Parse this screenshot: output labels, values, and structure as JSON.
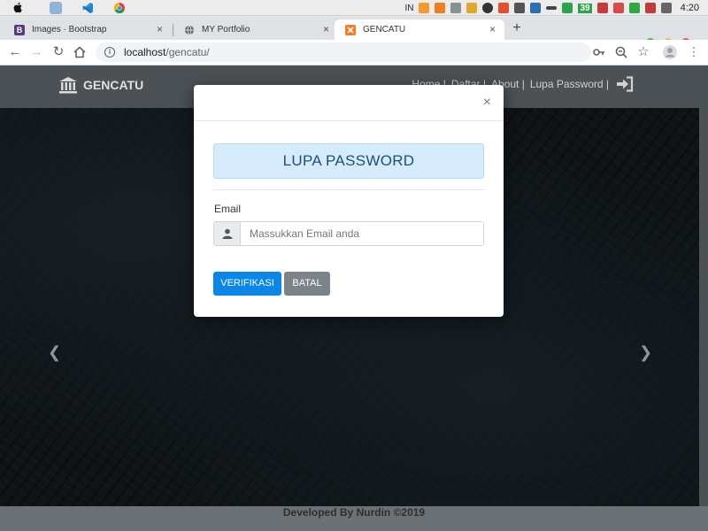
{
  "menubar": {
    "input_source": "IN",
    "badge_count": "39",
    "clock": "4:20"
  },
  "browser": {
    "tabs": [
      {
        "label": "Images · Bootstrap",
        "favicon": "B",
        "favicon_color": "#563d7c",
        "active": false
      },
      {
        "label": "MY Portfolio",
        "favicon": "globe",
        "active": false
      },
      {
        "label": "GENCATU",
        "favicon": "xampp",
        "favicon_color": "#fb7a24",
        "active": true
      }
    ],
    "new_tab": "+",
    "address": {
      "host": "localhost",
      "path": "/gencatu/"
    }
  },
  "site": {
    "brand": "GENCATU",
    "nav": [
      "Home |",
      "Daftar |",
      "About |",
      "Lupa Password |"
    ],
    "footer": "Developed By Nurdin ©2019"
  },
  "modal": {
    "close": "×",
    "title": "LUPA PASSWORD",
    "email_label": "Email",
    "email_placeholder": "Massukkan Email anda",
    "email_value": "",
    "verify_button": "VERIFIKASI",
    "cancel_button": "BATAL"
  },
  "colors": {
    "primary": "#0a86e8",
    "secondary": "#7b8288",
    "title_bg": "#d6ebfb",
    "title_text": "#1d4f7d",
    "navbar": "#4b5155"
  }
}
